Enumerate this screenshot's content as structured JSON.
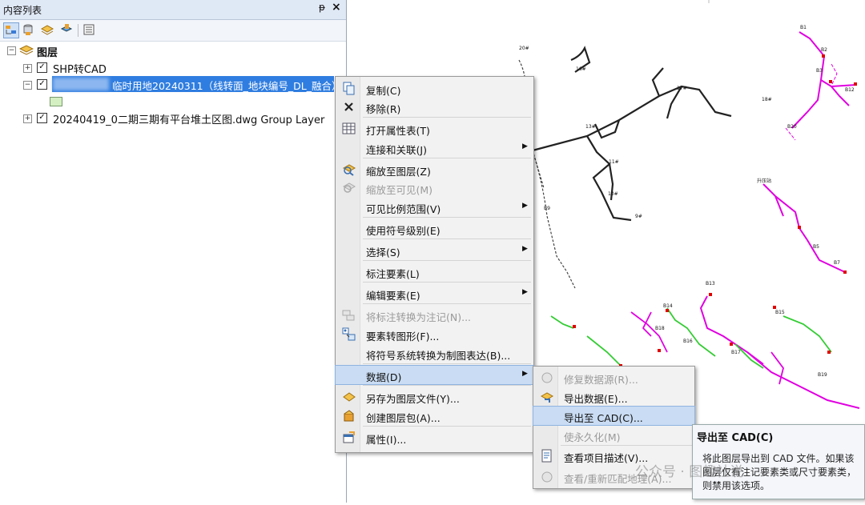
{
  "toc": {
    "title": "内容列表",
    "pin": "ᵽ",
    "close": "×",
    "root_label": "图层",
    "layers": [
      {
        "name": "SHP转CAD",
        "checked": "✓"
      },
      {
        "name": "临时用地20240311（线转面_地块编号_DL_融合）",
        "checked": "✓"
      },
      {
        "name": "20240419_0二期三期有平台堆土区图.dwg Group Layer",
        "checked": "✓"
      }
    ],
    "expand_plus": "+",
    "expand_minus": "−"
  },
  "context_menu": {
    "items": [
      {
        "label": "复制(C)",
        "icon": "copy-icon",
        "disabled": false
      },
      {
        "label": "移除(R)",
        "icon": "remove-icon",
        "disabled": false
      },
      {
        "label": "打开属性表(T)",
        "icon": "table-icon",
        "disabled": false
      },
      {
        "label": "连接和关联(J)",
        "icon": "",
        "disabled": false,
        "submenu": true
      },
      {
        "label": "缩放至图层(Z)",
        "icon": "zoom-layer-icon",
        "disabled": false
      },
      {
        "label": "缩放至可见(M)",
        "icon": "zoom-visible-icon",
        "disabled": true
      },
      {
        "label": "可见比例范围(V)",
        "icon": "",
        "disabled": false,
        "submenu": true
      },
      {
        "label": "使用符号级别(E)",
        "icon": "",
        "disabled": false
      },
      {
        "label": "选择(S)",
        "icon": "",
        "disabled": false,
        "submenu": true
      },
      {
        "label": "标注要素(L)",
        "icon": "",
        "disabled": false
      },
      {
        "label": "编辑要素(E)",
        "icon": "",
        "disabled": false,
        "submenu": true
      },
      {
        "label": "将标注转换为注记(N)...",
        "icon": "label-convert-icon",
        "disabled": true
      },
      {
        "label": "要素转图形(F)...",
        "icon": "feature-graphic-icon",
        "disabled": false
      },
      {
        "label": "将符号系统转换为制图表达(B)...",
        "icon": "",
        "disabled": false
      },
      {
        "label": "数据(D)",
        "icon": "",
        "disabled": false,
        "submenu": true,
        "highlight": true
      },
      {
        "label": "另存为图层文件(Y)...",
        "icon": "layer-file-icon",
        "disabled": false
      },
      {
        "label": "创建图层包(A)...",
        "icon": "layer-package-icon",
        "disabled": false
      },
      {
        "label": "属性(I)...",
        "icon": "properties-icon",
        "disabled": false
      }
    ],
    "arrow": "▶"
  },
  "data_submenu": {
    "items": [
      {
        "label": "修复数据源(R)...",
        "icon": "repair-icon",
        "disabled": true
      },
      {
        "label": "导出数据(E)...",
        "icon": "export-data-icon",
        "disabled": false
      },
      {
        "label": "导出至 CAD(C)...",
        "icon": "",
        "disabled": false,
        "highlight": true
      },
      {
        "label": "使永久化(M)",
        "icon": "",
        "disabled": true
      },
      {
        "label": "查看项目描述(V)...",
        "icon": "item-desc-icon",
        "disabled": false
      },
      {
        "label": "查看/重新匹配地理(A)...",
        "icon": "rematch-icon",
        "disabled": true
      }
    ]
  },
  "tooltip": {
    "title": "导出至 CAD(C)",
    "desc": "将此图层导出到 CAD 文件。如果该图层仅有注记要素类或尺寸要素类，则禁用该选项。"
  },
  "watermark": "公众号 · 图趣社说",
  "map_labels": [
    "20#",
    "16#",
    "17#",
    "13#",
    "11#",
    "10#",
    "9#",
    "18#",
    "B1",
    "B2",
    "B3",
    "B12",
    "B5",
    "B7",
    "B13",
    "B14",
    "B15",
    "B16",
    "B17",
    "B18",
    "B19",
    "B20",
    "B9",
    "B4",
    "升压站"
  ],
  "colors": {
    "highlight": "#2f7de0",
    "menu_hl": "#c9dcf3",
    "magenta": "#e000e0",
    "green": "#33cc33",
    "red": "#e00000"
  }
}
